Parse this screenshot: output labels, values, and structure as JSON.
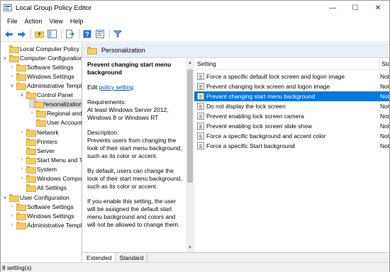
{
  "window": {
    "title": "Local Group Policy Editor",
    "controls": {
      "minimize": "—",
      "maximize": "☐",
      "close": "✕"
    }
  },
  "menu": [
    "File",
    "Action",
    "View",
    "Help"
  ],
  "toolbar_icons": [
    "back-arrow-icon",
    "forward-arrow-icon",
    "up-folder-icon",
    "console-tree-icon",
    "export-list-icon",
    "help-icon",
    "properties-icon",
    "filter-icon"
  ],
  "tree": {
    "root": "Local Computer Policy",
    "computer_config": "Computer Configuration",
    "cc_software": "Software Settings",
    "cc_windows": "Windows Settings",
    "cc_admin": "Administrative Templates",
    "control_panel": "Control Panel",
    "personalization": "Personalization",
    "regional": "Regional and Language Options",
    "user_accounts": "User Accounts",
    "network": "Network",
    "printers": "Printers",
    "server": "Server",
    "start_menu": "Start Menu and Taskbar",
    "system": "System",
    "windows_components": "Windows Components",
    "all_settings": "All Settings",
    "user_config": "User Configuration",
    "uc_software": "Software Settings",
    "uc_windows": "Windows Settings",
    "uc_admin": "Administrative Templates"
  },
  "header": {
    "title": "Personalization"
  },
  "description": {
    "title": "Prevent changing start menu background",
    "edit_prefix": "Edit ",
    "edit_link": "policy setting",
    "req_label": "Requirements:",
    "req_text": "At least Windows Server 2012, Windows 8 or Windows RT",
    "desc_label": "Description:",
    "desc_text": "Prevents users from changing the look of their start menu background, such as its color or accent.",
    "default_text": "By default, users can change the look of their start menu background, such as its color or accent.",
    "enable_text": "If you enable this setting, the user will be assigned the default start menu background and colors and will not be allowed to change them."
  },
  "list": {
    "col_setting": "Setting",
    "col_state": "State",
    "rows": [
      {
        "name": "Force a specific default lock screen and logon image",
        "state": "Not configured"
      },
      {
        "name": "Prevent changing lock screen and logon image",
        "state": "Not configured"
      },
      {
        "name": "Prevent changing start menu background",
        "state": "Not configured"
      },
      {
        "name": "Do not display the lock screen",
        "state": "Not configured"
      },
      {
        "name": "Prevent enabling lock screen camera",
        "state": "Not configured"
      },
      {
        "name": "Prevent enabling lock screen slide show",
        "state": "Not configured"
      },
      {
        "name": "Force a specific background and accent color",
        "state": "Not configured"
      },
      {
        "name": "Force a specific Start background",
        "state": "Not configured"
      }
    ]
  },
  "tabs": [
    "Extended",
    "Standard"
  ],
  "status": "8 setting(s)",
  "colors": {
    "selection": "#0078d7",
    "header_bg": "#e8eef7"
  }
}
